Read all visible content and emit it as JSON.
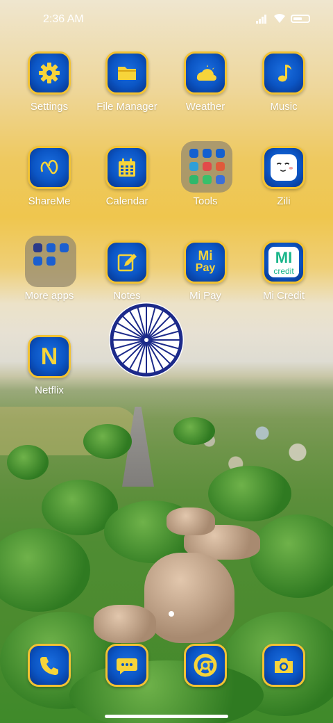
{
  "status_bar": {
    "time": "2:36 AM"
  },
  "apps": [
    {
      "name": "Settings",
      "icon": "gear-icon"
    },
    {
      "name": "File Manager",
      "icon": "folder-icon"
    },
    {
      "name": "Weather",
      "icon": "cloud-sun-icon"
    },
    {
      "name": "Music",
      "icon": "music-note-icon"
    },
    {
      "name": "ShareMe",
      "icon": "shareme-loop-icon"
    },
    {
      "name": "Calendar",
      "icon": "calendar-icon"
    },
    {
      "name": "Tools",
      "icon": "folder-grid-icon"
    },
    {
      "name": "Zili",
      "icon": "zili-face-icon"
    },
    {
      "name": "More apps",
      "icon": "folder-grid-icon"
    },
    {
      "name": "Notes",
      "icon": "notes-pencil-icon"
    },
    {
      "name": "Mi Pay",
      "icon": "mi-pay-icon"
    },
    {
      "name": "Mi Credit",
      "icon": "mi-credit-icon"
    },
    {
      "name": "Netflix",
      "icon": "netflix-n-icon"
    }
  ],
  "mi_pay_text": {
    "line1": "Mi",
    "line2": "Pay"
  },
  "mi_credit_text": {
    "line1": "MI",
    "line2": "credit"
  },
  "netflix_letter": "N",
  "dock": [
    {
      "icon": "phone-icon"
    },
    {
      "icon": "message-icon"
    },
    {
      "icon": "chrome-icon"
    },
    {
      "icon": "camera-icon"
    }
  ],
  "colors": {
    "icon_blue": "#0b55c4",
    "icon_border": "#f2c233",
    "icon_glyph": "#f7d43a",
    "label": "#ffffff"
  }
}
